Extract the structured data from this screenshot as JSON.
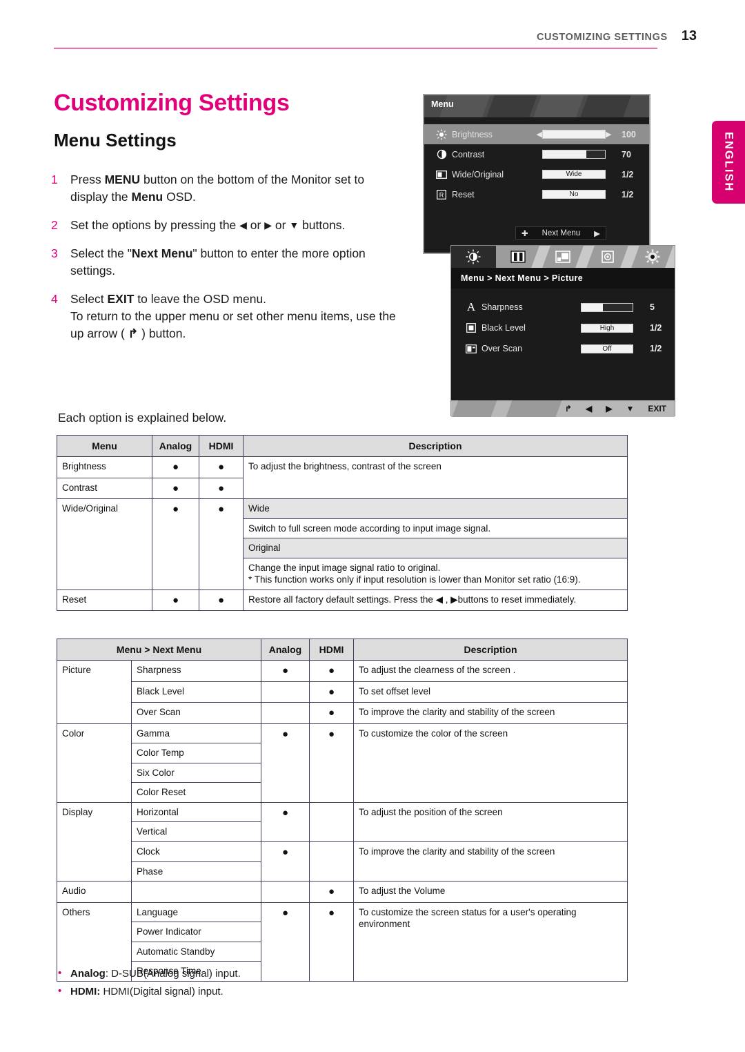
{
  "header": {
    "title": "CUSTOMIZING SETTINGS",
    "page_number": "13"
  },
  "language_tab": {
    "label": "ENGLISH"
  },
  "titles": {
    "h1": "Customizing Settings",
    "h2": "Menu Settings"
  },
  "steps": [
    {
      "num": "1",
      "html": "Press <b>MENU</b> button on the bottom of the Monitor set to display the <b>Menu</b> OSD."
    },
    {
      "num": "2",
      "html": "Set the options by pressing the <span class=\"ar\">◀</span> or <span class=\"ar\">▶</span> or <span class=\"ar\">▼</span> buttons."
    },
    {
      "num": "3",
      "html": "Select the \"<b>Next Menu</b>\" button to enter the more option settings."
    },
    {
      "num": "4",
      "html": "Select <b>EXIT</b> to leave the OSD menu.<br>To return to the upper menu or set other menu items, use the up arrow ( <b>↱</b> ) button."
    }
  ],
  "each_option_text": "Each option is explained below.",
  "osd_menu": {
    "title": "Menu",
    "rows": [
      {
        "icon": "brightness-icon",
        "name": "Brightness",
        "control": "slider",
        "fill_percent": 100,
        "value": "100",
        "selected": true
      },
      {
        "icon": "contrast-icon",
        "name": "Contrast",
        "control": "slider",
        "fill_percent": 70,
        "value": "70",
        "selected": false
      },
      {
        "icon": "wide-original-icon",
        "name": "Wide/Original",
        "control": "tag",
        "tag": "Wide",
        "value": "1/2",
        "selected": false
      },
      {
        "icon": "reset-icon",
        "name": "Reset",
        "control": "tag",
        "tag": "No",
        "value": "1/2",
        "selected": false
      }
    ],
    "next_menu_label": "Next Menu"
  },
  "osd_picture": {
    "breadcrumb": "Menu > Next Menu > Picture",
    "tabs": [
      "picture-tab-icon",
      "color-tab-icon",
      "display-tab-icon",
      "audio-tab-icon",
      "others-tab-icon"
    ],
    "rows": [
      {
        "icon": "sharpness-icon",
        "name": "Sharpness",
        "control": "slider",
        "fill_percent": 42,
        "value": "5"
      },
      {
        "icon": "black-level-icon",
        "name": "Black Level",
        "control": "tag",
        "tag": "High",
        "value": "1/2"
      },
      {
        "icon": "over-scan-icon",
        "name": "Over Scan",
        "control": "tag",
        "tag": "Off",
        "value": "1/2"
      }
    ],
    "footer_buttons": [
      "↱",
      "◀",
      "▶",
      "▼",
      "EXIT"
    ]
  },
  "table_menu": {
    "headers": [
      "Menu",
      "Analog",
      "HDMI",
      "Description"
    ],
    "rows": [
      {
        "menu": "Brightness",
        "analog": "●",
        "hdmi": "●"
      },
      {
        "menu": "Contrast",
        "analog": "●",
        "hdmi": "●"
      },
      {
        "menu": "Wide/Original",
        "analog": "●",
        "hdmi": "●"
      },
      {
        "menu": "Reset",
        "analog": "●",
        "hdmi": "●"
      }
    ],
    "desc_brightness_contrast": "To adjust the brightness, contrast of the screen",
    "sub_wide": "Wide",
    "desc_wide": "Switch to full screen mode according to input image signal.",
    "sub_original": "Original",
    "desc_original": "Change the input image signal ratio to original.\n* This function works only if input resolution is lower than Monitor set ratio (16:9).",
    "desc_reset": "Restore all factory default settings. Press the ◀ , ▶buttons to reset immediately."
  },
  "table_next_menu": {
    "headers": [
      "Menu > Next Menu",
      "Analog",
      "HDMI",
      "Description"
    ],
    "groups": [
      {
        "group": "Picture",
        "items": [
          {
            "name": "Sharpness",
            "analog": "●",
            "hdmi": "●",
            "desc": "To adjust the clearness of the screen ."
          },
          {
            "name": "Black Level",
            "analog": "",
            "hdmi": "●",
            "desc": "To set offset level"
          },
          {
            "name": "Over Scan",
            "analog": "",
            "hdmi": "●",
            "desc": "To improve the clarity and stability of the screen"
          }
        ]
      },
      {
        "group": "Color",
        "items": [
          {
            "name": "Gamma"
          },
          {
            "name": "Color Temp"
          },
          {
            "name": "Six Color"
          },
          {
            "name": "Color Reset"
          }
        ],
        "analog": "●",
        "hdmi": "●",
        "desc": "To customize the color of the screen"
      },
      {
        "group": "Display",
        "items": [
          {
            "name": "Horizontal"
          },
          {
            "name": "Vertical"
          }
        ],
        "analog": "●",
        "hdmi": "",
        "desc": "To adjust the position of the screen",
        "items2": [
          {
            "name": "Clock"
          },
          {
            "name": "Phase"
          }
        ],
        "analog2": "●",
        "hdmi2": "",
        "desc2": "To improve the clarity and stability of the screen"
      },
      {
        "group": "Audio",
        "items": [],
        "analog": "",
        "hdmi": "●",
        "desc": "To adjust the Volume"
      },
      {
        "group": "Others",
        "items": [
          {
            "name": "Language"
          },
          {
            "name": "Power Indicator"
          },
          {
            "name": "Automatic Standby"
          },
          {
            "name": "Response Time"
          }
        ],
        "analog": "●",
        "hdmi": "●",
        "desc": "To customize the screen status for a user's operating environment"
      }
    ]
  },
  "footnotes": [
    {
      "term": "Analog",
      "text": ": D-SUB(Analog signal) input."
    },
    {
      "term": "HDMI:",
      "text": " HDMI(Digital signal) input."
    }
  ],
  "colors": {
    "accent": "#e2007a",
    "rule": "#ef72b0",
    "tab": "#d6006e"
  }
}
